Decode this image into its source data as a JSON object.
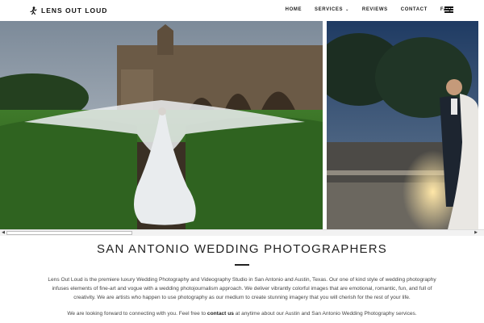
{
  "header": {
    "logo_text": "LENS OUT LOUD",
    "nav": [
      {
        "label": "HOME"
      },
      {
        "label": "SERVICES",
        "has_dropdown": true
      },
      {
        "label": "REVIEWS"
      },
      {
        "label": "CONTACT"
      },
      {
        "label": "FAQ"
      }
    ],
    "icons": {
      "logo": "logo-figure-icon",
      "menu": "hamburger-menu-icon",
      "dropdown": "chevron-down-icon"
    }
  },
  "gallery": {
    "scroll_left_arrow": "◀",
    "scroll_right_arrow": "▶"
  },
  "main": {
    "title": "SAN ANTONIO WEDDING PHOTOGRAPHERS",
    "paragraph_1": "Lens Out Loud is the premiere luxury Wedding Photography and Videography Studio in San Antonio and Austin, Texas. Our one of kind style of wedding photography infuses elements of fine-art and vogue with a wedding photojournalism approach. We deliver vibrantly colorful images that are emotional, romantic, fun, and full of creativity. We are artists who happen to use photography as our medium to create stunning imagery that you will cherish for the rest of your life.",
    "paragraph_2_before": "We are looking forward to connecting with you. Feel free to ",
    "paragraph_2_link": "contact us",
    "paragraph_2_after": " at anytime about our Austin and San Antonio Wedding Photography services."
  },
  "colors": {
    "text": "#333333",
    "heading": "#222222",
    "background": "#ffffff"
  }
}
